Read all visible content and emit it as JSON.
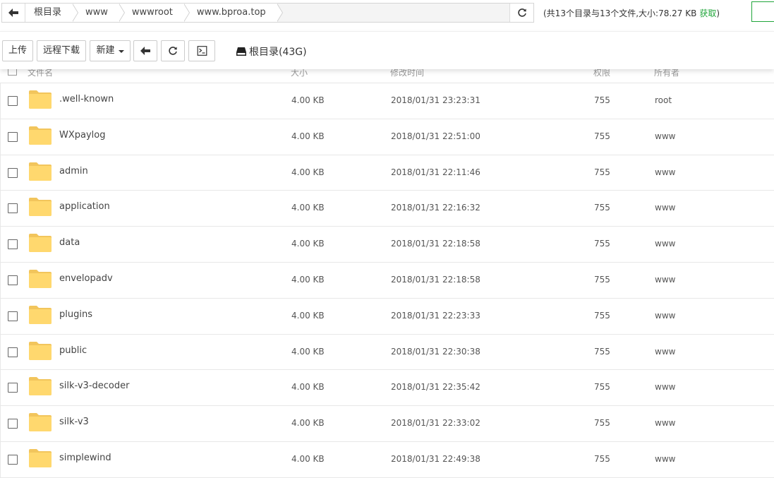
{
  "breadcrumb": [
    "根目录",
    "www",
    "wwwroot",
    "www.bproa.top"
  ],
  "summary": {
    "text": "(共13个目录与13个文件,大小:78.27 KB",
    "fetch": "获取",
    "close": ")"
  },
  "toolbar": {
    "upload": "上传",
    "remote_download": "远程下载",
    "new": "新建",
    "disk": "根目录(43G)"
  },
  "table": {
    "headers": {
      "name": "文件名",
      "size": "大小",
      "mtime": "修改时间",
      "perm": "权限",
      "owner": "所有者"
    },
    "rows": [
      {
        "name": ".well-known",
        "size": "4.00 KB",
        "mtime": "2018/01/31 23:23:31",
        "perm": "755",
        "owner": "root"
      },
      {
        "name": "WXpaylog",
        "size": "4.00 KB",
        "mtime": "2018/01/31 22:51:00",
        "perm": "755",
        "owner": "www"
      },
      {
        "name": "admin",
        "size": "4.00 KB",
        "mtime": "2018/01/31 22:11:46",
        "perm": "755",
        "owner": "www"
      },
      {
        "name": "application",
        "size": "4.00 KB",
        "mtime": "2018/01/31 22:16:32",
        "perm": "755",
        "owner": "www"
      },
      {
        "name": "data",
        "size": "4.00 KB",
        "mtime": "2018/01/31 22:18:58",
        "perm": "755",
        "owner": "www"
      },
      {
        "name": "envelopadv",
        "size": "4.00 KB",
        "mtime": "2018/01/31 22:18:58",
        "perm": "755",
        "owner": "www"
      },
      {
        "name": "plugins",
        "size": "4.00 KB",
        "mtime": "2018/01/31 22:23:33",
        "perm": "755",
        "owner": "www"
      },
      {
        "name": "public",
        "size": "4.00 KB",
        "mtime": "2018/01/31 22:30:38",
        "perm": "755",
        "owner": "www"
      },
      {
        "name": "silk-v3-decoder",
        "size": "4.00 KB",
        "mtime": "2018/01/31 22:35:42",
        "perm": "755",
        "owner": "www"
      },
      {
        "name": "silk-v3",
        "size": "4.00 KB",
        "mtime": "2018/01/31 22:33:02",
        "perm": "755",
        "owner": "www"
      },
      {
        "name": "simplewind",
        "size": "4.00 KB",
        "mtime": "2018/01/31 22:49:38",
        "perm": "755",
        "owner": "www"
      }
    ]
  },
  "colors": {
    "accent": "#20a53a",
    "folder": "#ffd86e"
  },
  "icons": {
    "back": "arrow-left-icon",
    "refresh": "refresh-icon",
    "terminal": "terminal-icon",
    "disk": "hard-drive-icon",
    "folder": "folder-icon"
  }
}
